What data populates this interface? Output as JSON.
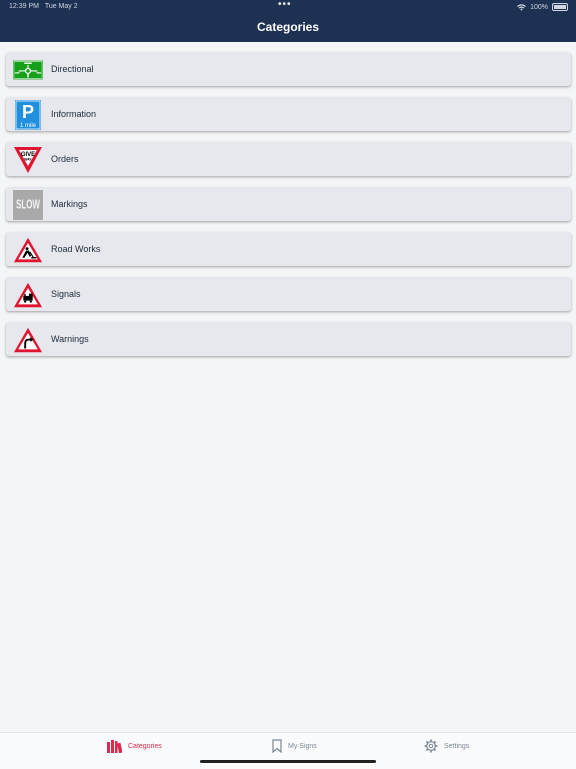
{
  "status": {
    "time": "12:39 PM",
    "date": "Tue May 2",
    "battery": "100%"
  },
  "header": {
    "title": "Categories"
  },
  "categories": [
    {
      "label": "Directional",
      "icon": "roundabout-sign-icon"
    },
    {
      "label": "Information",
      "icon": "parking-sign-icon",
      "icon_text": [
        "P",
        "1 mile"
      ]
    },
    {
      "label": "Orders",
      "icon": "give-way-sign-icon",
      "icon_text": [
        "GIVE",
        "WAY"
      ]
    },
    {
      "label": "Markings",
      "icon": "slow-marking-icon",
      "icon_text": [
        "SLOW"
      ]
    },
    {
      "label": "Road Works",
      "icon": "road-works-sign-icon"
    },
    {
      "label": "Signals",
      "icon": "level-crossing-sign-icon"
    },
    {
      "label": "Warnings",
      "icon": "bend-warning-sign-icon"
    }
  ],
  "tabbar": {
    "items": [
      {
        "label": "Categories",
        "icon": "books-icon",
        "active": true
      },
      {
        "label": "My Signs",
        "icon": "bookmark-icon",
        "active": false
      },
      {
        "label": "Settings",
        "icon": "gear-icon",
        "active": false
      }
    ]
  },
  "colors": {
    "header": "#1d3152",
    "accent": "#e0284c",
    "row": "#e6e8ee",
    "background": "#f4f5f7"
  }
}
